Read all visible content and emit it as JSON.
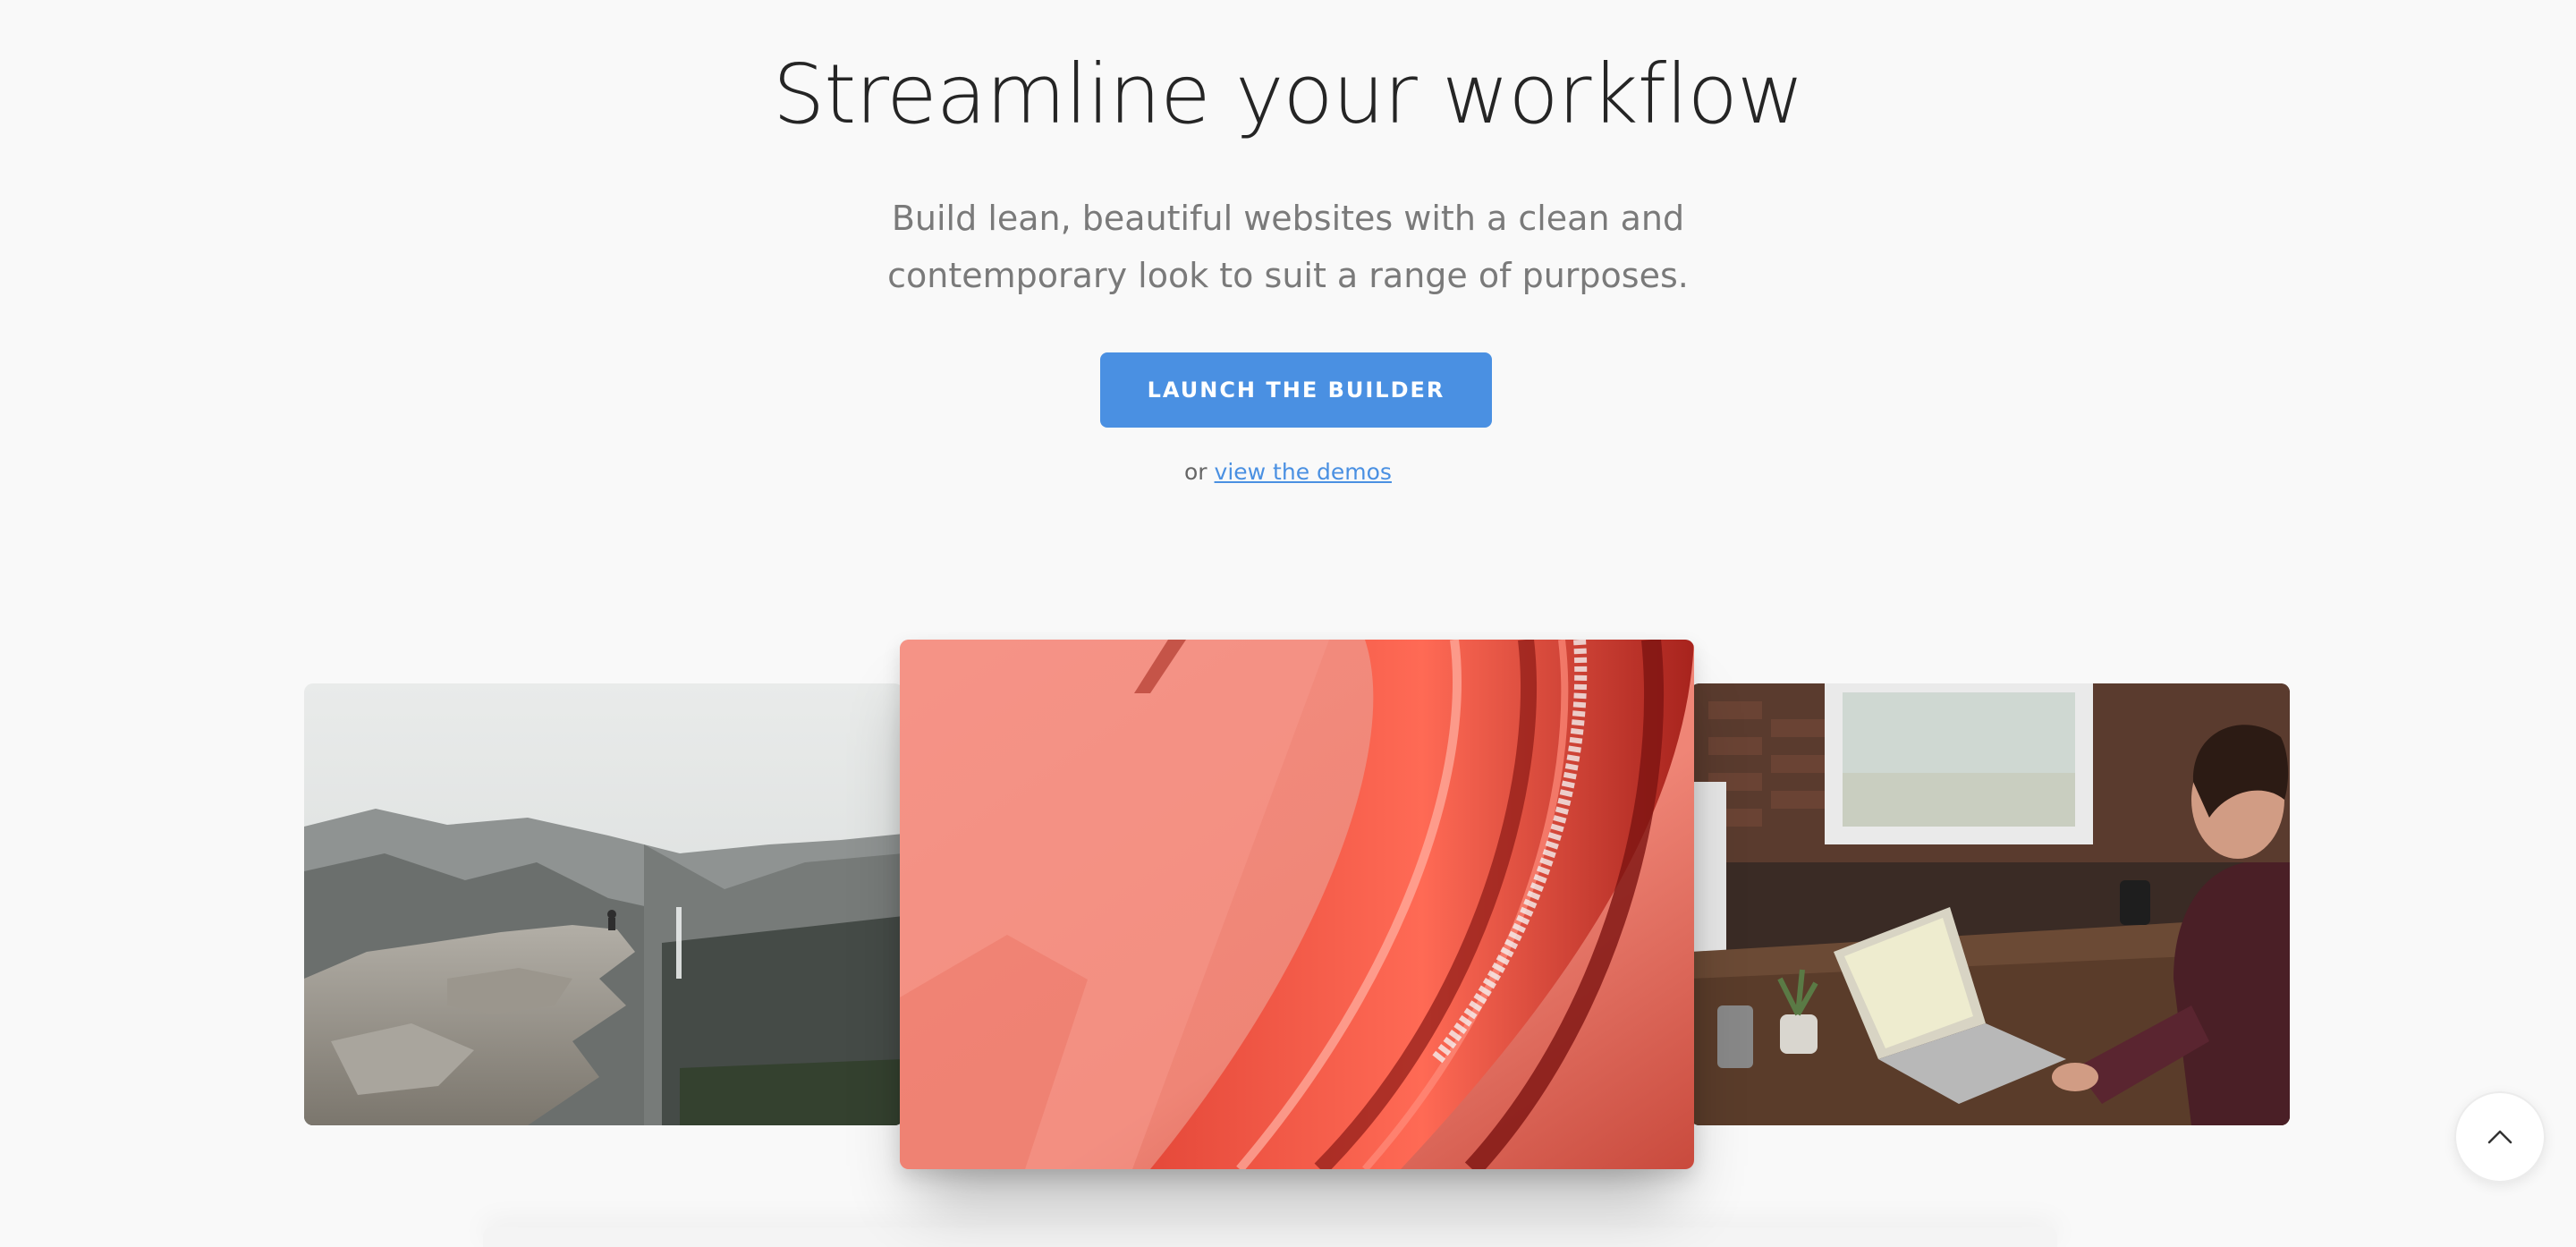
{
  "hero": {
    "title": "Streamline your workflow",
    "subtitle": "Build lean, beautiful websites with a clean and contemporary look to suit a range of purposes.",
    "cta_label": "LAUNCH THE BUILDER",
    "alt_prefix": "or",
    "alt_link": "view the demos"
  },
  "gallery": {
    "images": [
      {
        "name": "mountain-cliff-photo"
      },
      {
        "name": "red-car-taillight-photo"
      },
      {
        "name": "man-working-laptop-photo"
      }
    ]
  },
  "back_to_top": {
    "icon": "chevron-up-icon"
  },
  "colors": {
    "background": "#f9f9f9",
    "accent": "#4a90e2",
    "title": "#252525",
    "subtitle": "#7a7a7a"
  }
}
